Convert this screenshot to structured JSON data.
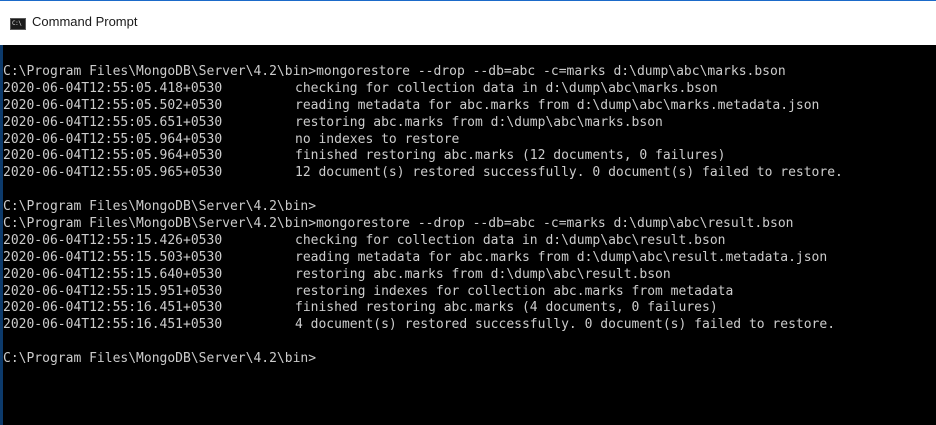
{
  "window": {
    "title": "Command Prompt",
    "icon": "cmd-icon",
    "icon_text": "C:\\"
  },
  "console": {
    "lines": [
      {
        "type": "cmd",
        "text": "C:\\Program Files\\MongoDB\\Server\\4.2\\bin>mongorestore --drop --db=abc -c=marks d:\\dump\\abc\\marks.bson"
      },
      {
        "type": "log",
        "ts": "2020-06-04T12:55:05.418+0530",
        "msg": "checking for collection data in d:\\dump\\abc\\marks.bson"
      },
      {
        "type": "log",
        "ts": "2020-06-04T12:55:05.502+0530",
        "msg": "reading metadata for abc.marks from d:\\dump\\abc\\marks.metadata.json"
      },
      {
        "type": "log",
        "ts": "2020-06-04T12:55:05.651+0530",
        "msg": "restoring abc.marks from d:\\dump\\abc\\marks.bson"
      },
      {
        "type": "log",
        "ts": "2020-06-04T12:55:05.964+0530",
        "msg": "no indexes to restore"
      },
      {
        "type": "log",
        "ts": "2020-06-04T12:55:05.964+0530",
        "msg": "finished restoring abc.marks (12 documents, 0 failures)"
      },
      {
        "type": "log",
        "ts": "2020-06-04T12:55:05.965+0530",
        "msg": "12 document(s) restored successfully. 0 document(s) failed to restore."
      },
      {
        "type": "blank",
        "text": ""
      },
      {
        "type": "cmd",
        "text": "C:\\Program Files\\MongoDB\\Server\\4.2\\bin>"
      },
      {
        "type": "cmd",
        "text": "C:\\Program Files\\MongoDB\\Server\\4.2\\bin>mongorestore --drop --db=abc -c=marks d:\\dump\\abc\\result.bson"
      },
      {
        "type": "log",
        "ts": "2020-06-04T12:55:15.426+0530",
        "msg": "checking for collection data in d:\\dump\\abc\\result.bson"
      },
      {
        "type": "log",
        "ts": "2020-06-04T12:55:15.503+0530",
        "msg": "reading metadata for abc.marks from d:\\dump\\abc\\result.metadata.json"
      },
      {
        "type": "log",
        "ts": "2020-06-04T12:55:15.640+0530",
        "msg": "restoring abc.marks from d:\\dump\\abc\\result.bson"
      },
      {
        "type": "log",
        "ts": "2020-06-04T12:55:15.951+0530",
        "msg": "restoring indexes for collection abc.marks from metadata"
      },
      {
        "type": "log",
        "ts": "2020-06-04T12:55:16.451+0530",
        "msg": "finished restoring abc.marks (4 documents, 0 failures)"
      },
      {
        "type": "log",
        "ts": "2020-06-04T12:55:16.451+0530",
        "msg": "4 document(s) restored successfully. 0 document(s) failed to restore."
      },
      {
        "type": "blank",
        "text": ""
      },
      {
        "type": "cmd",
        "text": "C:\\Program Files\\MongoDB\\Server\\4.2\\bin>"
      }
    ]
  },
  "colors": {
    "console_background": "#000000",
    "console_text": "#cccccc",
    "titlebar_background": "#ffffff",
    "window_border": "#1b6ac9"
  }
}
